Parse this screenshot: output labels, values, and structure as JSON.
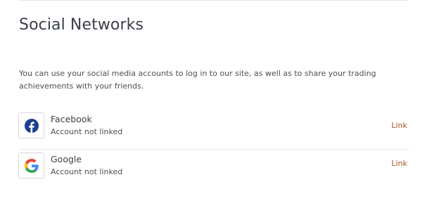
{
  "section": {
    "title": "Social Networks",
    "description": "You can use your social media accounts to log in to our site, as well as to share your trading achievements with your friends."
  },
  "networks": [
    {
      "name": "Facebook",
      "status": "Account not linked",
      "action_label": "Link",
      "icon": "facebook-icon",
      "brand_color": "#1b3f8e"
    },
    {
      "name": "Google",
      "status": "Account not linked",
      "action_label": "Link",
      "icon": "google-icon",
      "brand_colors": [
        "#4285F4",
        "#EA4335",
        "#FBBC05",
        "#34A853"
      ]
    }
  ],
  "colors": {
    "link": "#b0542a"
  }
}
